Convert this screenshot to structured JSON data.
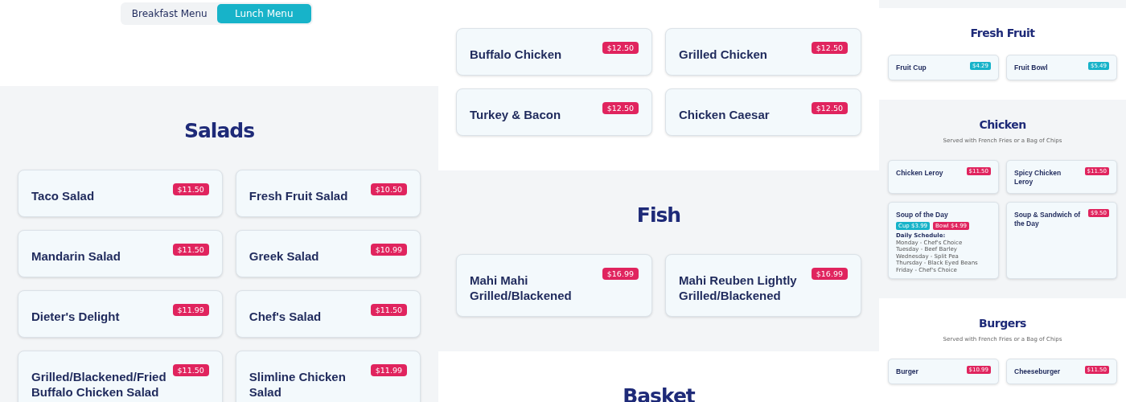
{
  "panels": [
    {
      "sections": [
        {
          "kind": "toggle",
          "tabs": [
            {
              "label": "Breakfast Menu",
              "selected": false
            },
            {
              "label": "Lunch Menu",
              "selected": true
            }
          ]
        },
        {
          "kind": "menu",
          "shaded": true,
          "title": "Salads",
          "items": [
            {
              "name": "Taco Salad",
              "prices": [
                {
                  "label": "$11.50",
                  "color": "#e0245e"
                }
              ]
            },
            {
              "name": "Fresh Fruit Salad",
              "prices": [
                {
                  "label": "$10.50",
                  "color": "#e0245e"
                }
              ]
            },
            {
              "name": "Mandarin Salad",
              "prices": [
                {
                  "label": "$11.50",
                  "color": "#e0245e"
                }
              ]
            },
            {
              "name": "Greek Salad",
              "prices": [
                {
                  "label": "$10.99",
                  "color": "#e0245e"
                }
              ]
            },
            {
              "name": "Dieter's Delight",
              "prices": [
                {
                  "label": "$11.99",
                  "color": "#e0245e"
                }
              ]
            },
            {
              "name": "Chef's Salad",
              "prices": [
                {
                  "label": "$11.50",
                  "color": "#e0245e"
                }
              ]
            },
            {
              "name": "Grilled/Blackened/Fried Buffalo Chicken Salad",
              "prices": [
                {
                  "label": "$11.50",
                  "color": "#e0245e"
                }
              ]
            },
            {
              "name": "Slimline Chicken Salad",
              "prices": [
                {
                  "label": "$11.99",
                  "color": "#e0245e"
                }
              ]
            }
          ]
        }
      ]
    },
    {
      "sections": [
        {
          "kind": "menu",
          "items": [
            {
              "name": "Buffalo Chicken",
              "prices": [
                {
                  "label": "$12.50",
                  "color": "#e0245e"
                }
              ]
            },
            {
              "name": "Grilled Chicken",
              "prices": [
                {
                  "label": "$12.50",
                  "color": "#e0245e"
                }
              ]
            },
            {
              "name": "Turkey & Bacon",
              "prices": [
                {
                  "label": "$12.50",
                  "color": "#e0245e"
                }
              ]
            },
            {
              "name": "Chicken Caesar",
              "prices": [
                {
                  "label": "$12.50",
                  "color": "#e0245e"
                }
              ]
            }
          ]
        },
        {
          "kind": "menu",
          "shaded": true,
          "title": "Fish",
          "items": [
            {
              "name": "Mahi Mahi Grilled/Blackened",
              "prices": [
                {
                  "label": "$16.99",
                  "color": "#e0245e"
                }
              ]
            },
            {
              "name": "Mahi Reuben Lightly Grilled/Blackened",
              "prices": [
                {
                  "label": "$16.99",
                  "color": "#e0245e"
                }
              ]
            }
          ]
        },
        {
          "kind": "menu",
          "title": "Basket"
        }
      ]
    },
    {
      "sections": [
        {
          "kind": "band",
          "shaded": true
        },
        {
          "kind": "menu",
          "title": "Fresh Fruit",
          "items": [
            {
              "name": "Fruit Cup",
              "prices": [
                {
                  "label": "$4.29",
                  "color": "#17b3c9"
                }
              ]
            },
            {
              "name": "Fruit Bowl",
              "prices": [
                {
                  "label": "$5.49",
                  "color": "#17b3c9"
                }
              ]
            }
          ]
        },
        {
          "kind": "menu",
          "shaded": true,
          "title": "Chicken",
          "subtitle": "Served with French Fries or a Bag of Chips",
          "items": [
            {
              "name": "Chicken Leroy",
              "prices": [
                {
                  "label": "$11.50",
                  "color": "#e0245e"
                }
              ]
            },
            {
              "name": "Spicy Chicken Leroy",
              "prices": [
                {
                  "label": "$11.50",
                  "color": "#e0245e"
                }
              ]
            },
            {
              "name": "Soup of the Day",
              "tags": [
                {
                  "label": "Cup $3.99",
                  "color": "#17b3c9"
                },
                {
                  "label": "Bowl $4.99",
                  "color": "#e0245e"
                }
              ],
              "schedule": {
                "title": "Daily Schedule:",
                "lines": [
                  "Monday - Chef's Choice",
                  "Tuesday - Beef Barley",
                  "Wednesday - Split Pea",
                  "Thursday - Black Eyed Beans",
                  "Friday - Chef's Choice"
                ]
              }
            },
            {
              "name": "Soup & Sandwich of the Day",
              "prices": [
                {
                  "label": "$9.50",
                  "color": "#e0245e"
                }
              ]
            }
          ]
        },
        {
          "kind": "menu",
          "title": "Burgers",
          "subtitle": "Served with French Fries or a Bag of Chips",
          "items": [
            {
              "name": "Burger",
              "prices": [
                {
                  "label": "$10.99",
                  "color": "#e0245e"
                }
              ]
            },
            {
              "name": "Cheeseburger",
              "prices": [
                {
                  "label": "$11.50",
                  "color": "#e0245e"
                }
              ]
            }
          ]
        }
      ]
    }
  ]
}
